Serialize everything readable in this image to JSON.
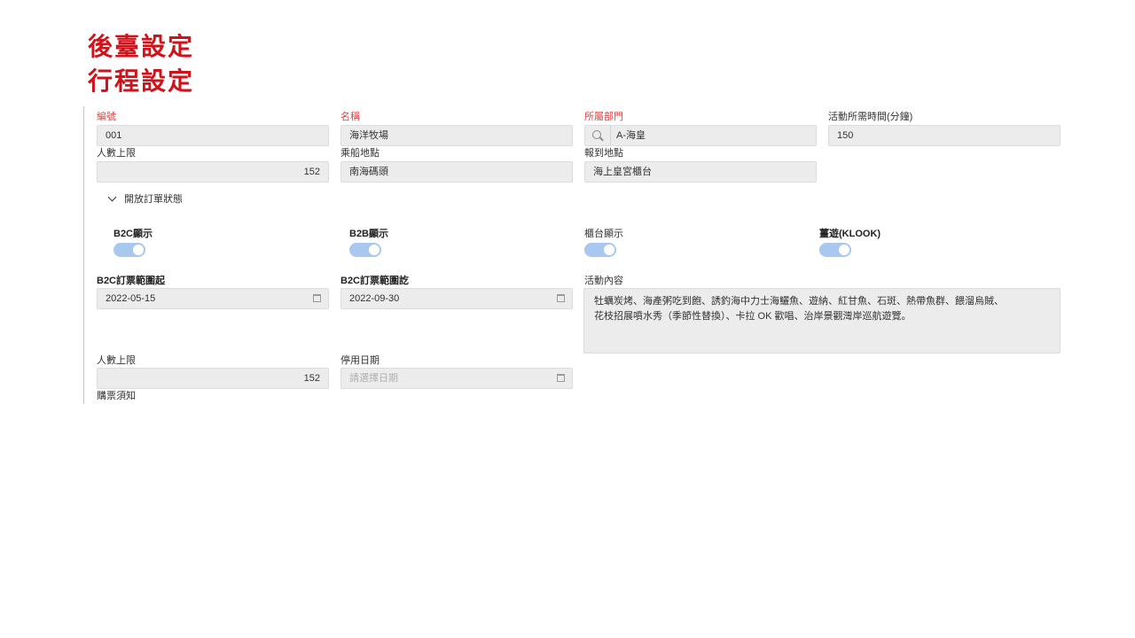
{
  "slide": {
    "title_line1": "後臺設定",
    "title_line2": "行程設定"
  },
  "form": {
    "row1": {
      "code": {
        "label": "編號",
        "value": "001"
      },
      "name": {
        "label": "名稱",
        "value": "海洋牧場"
      },
      "department": {
        "label": "所屬部門",
        "value": "A-海皇",
        "icon": "search-icon"
      },
      "duration": {
        "label": "活動所需時間(分鐘)",
        "value": "150"
      }
    },
    "row2": {
      "capacity": {
        "label": "人數上限",
        "value": "152"
      },
      "boarding": {
        "label": "乘船地點",
        "value": "南海碼頭"
      },
      "checkin": {
        "label": "報到地點",
        "value": "海上皇宮櫃台"
      }
    },
    "section": {
      "label": "開放訂單狀態",
      "icon": "chevron-down-icon"
    },
    "toggles": [
      {
        "label": "B2C顯示",
        "on": true
      },
      {
        "label": "B2B顯示",
        "on": true
      },
      {
        "label": "櫃台顯示",
        "on": true
      },
      {
        "label": "薑遊(KLOOK)",
        "on": true
      }
    ],
    "row3": {
      "b2c_start": {
        "label": "B2C訂票範圍起",
        "value": "2022-05-15",
        "icon": "calendar-icon"
      },
      "b2c_end": {
        "label": "B2C訂票範圍訖",
        "value": "2022-09-30",
        "icon": "calendar-icon"
      },
      "content": {
        "label": "活動內容",
        "line1": "牡蠣炭烤、海產粥吃到飽、誘釣海中力士海鱺魚、遊納、紅甘魚、石斑、熱帶魚群、餵溜烏賊、",
        "line2": "花枝招展噴水秀（季節性替換）、卡拉 OK 歡唱、治岸景觀灣岸巡航遊覽。"
      }
    },
    "row4": {
      "capacity2": {
        "label": "人數上限",
        "value": "152"
      },
      "stop_date": {
        "label": "停用日期",
        "placeholder": "請選擇日期",
        "icon": "calendar-icon"
      }
    },
    "notice": {
      "label": "購票須知"
    }
  },
  "colors": {
    "title_red": "#d0121b",
    "required_red": "#e04040",
    "toggle_blue": "#a9c8f0",
    "field_bg": "#ececec"
  }
}
